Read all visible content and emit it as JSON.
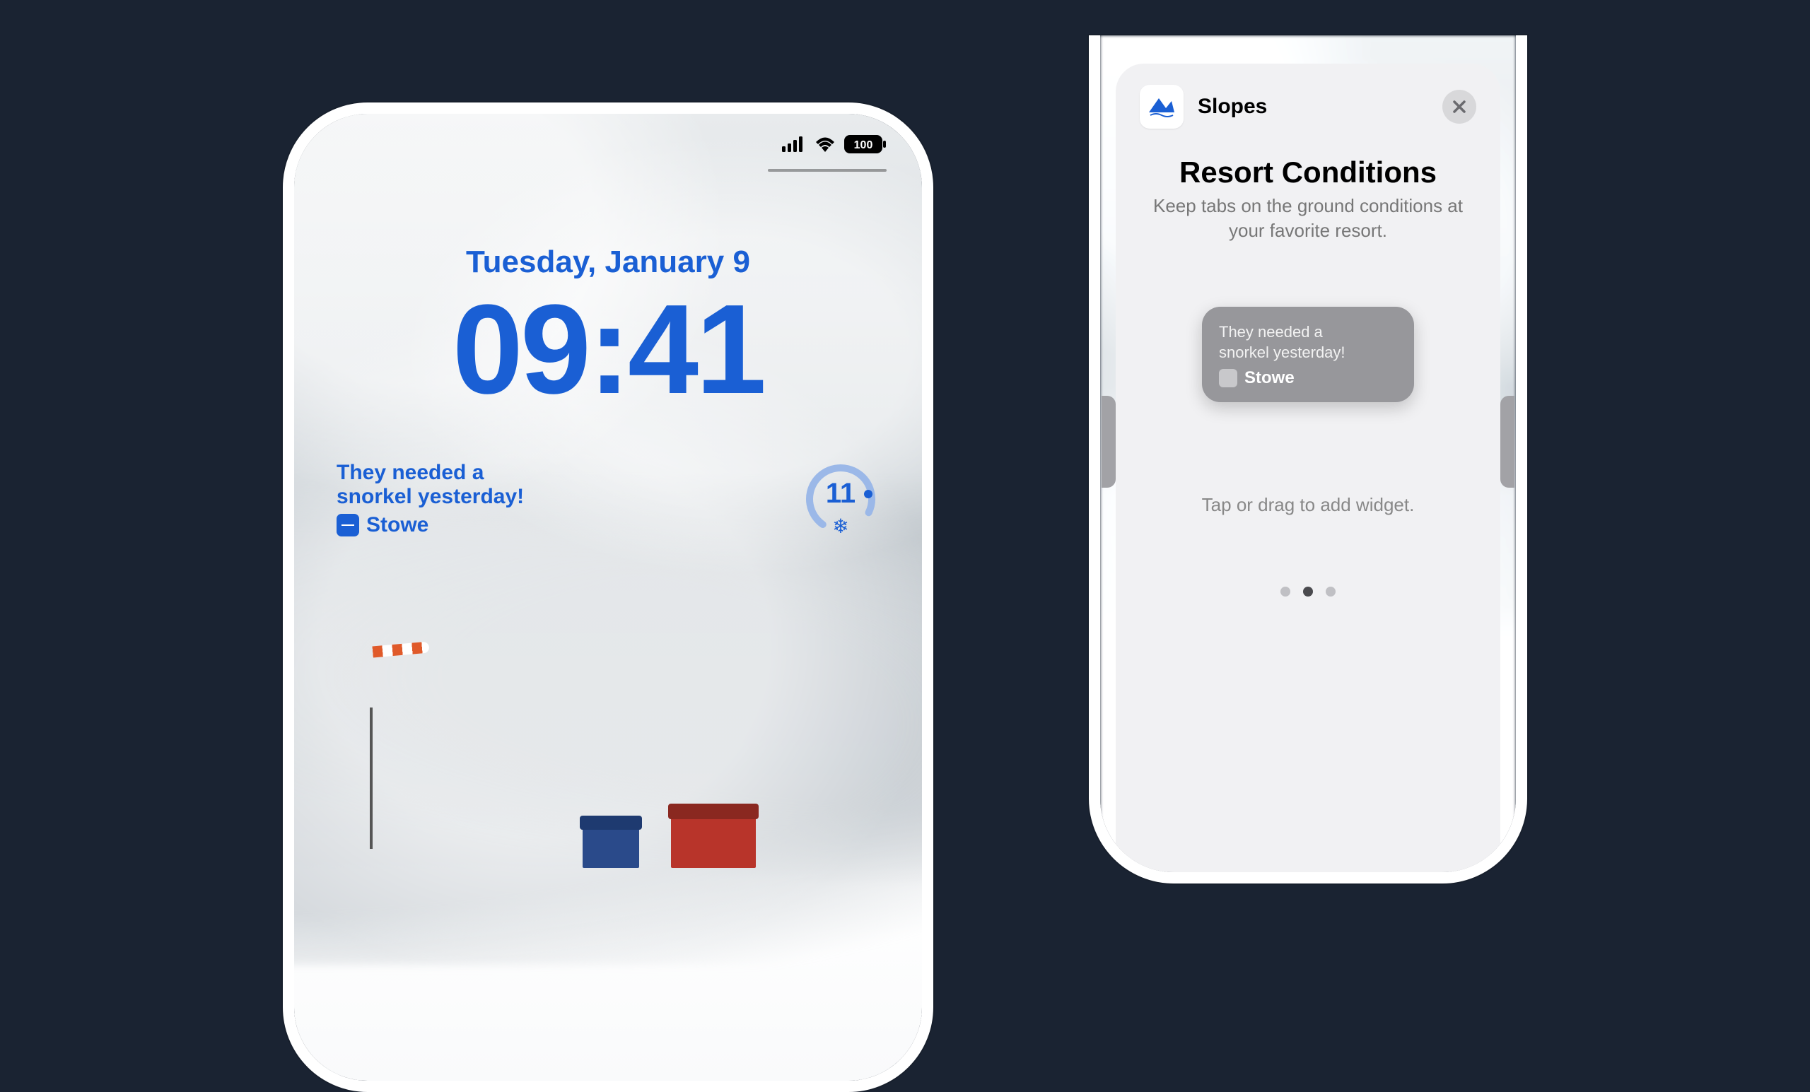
{
  "lock_screen": {
    "date": "Tuesday, January 9",
    "time": "09:41",
    "status_battery": "100",
    "widget": {
      "line1": "They needed a",
      "line2": "snorkel yesterday!",
      "resort_name": "Stowe",
      "circular_value": "11"
    }
  },
  "widget_gallery": {
    "app_name": "Slopes",
    "title": "Resort Conditions",
    "description": "Keep tabs on the ground conditions at your favorite resort.",
    "preview": {
      "line1": "They needed a",
      "line2": "snorkel yesterday!",
      "resort_name": "Stowe"
    },
    "instruction": "Tap or drag to add widget.",
    "page_index": 1,
    "page_count": 3
  },
  "colors": {
    "accent_blue": "#1a5fd4",
    "background": "#1a2332"
  }
}
